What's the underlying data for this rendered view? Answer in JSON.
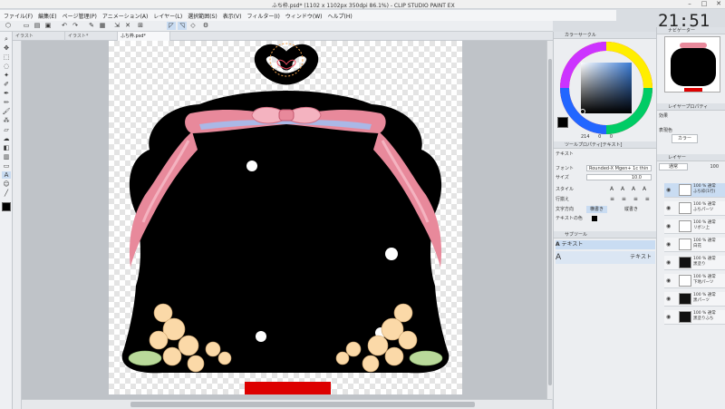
{
  "window": {
    "title": "ふち枠.psd* (1102 x 1102px 350dpi 86.1%) - CLIP STUDIO PAINT EX",
    "clock": "21:51"
  },
  "menu": [
    "ファイル(F)",
    "編集(E)",
    "ページ管理(P)",
    "アニメーション(A)",
    "レイヤー(L)",
    "選択範囲(S)",
    "表示(V)",
    "フィルター(I)",
    "ウィンドウ(W)",
    "ヘルプ(H)"
  ],
  "tabs": [
    "イラスト",
    "イラスト*",
    "ふち枠.psd*"
  ],
  "panels": {
    "color_circle": "カラーサークル",
    "navigator": "ナビゲーター",
    "layer_property": "レイヤープロパティ",
    "effect_label": "効果",
    "expression_label": "表現色",
    "expression_value": "カラー",
    "tool_property": "ツールプロパティ[テキスト]",
    "tool_name": "テキスト",
    "font_label": "フォント",
    "font_value": "Rounded-X Mgen+ 1c thin",
    "size_label": "サイズ",
    "size_value": "10.0",
    "style_label": "スタイル",
    "align_label": "行揃え",
    "direction_label": "文字方向",
    "direction_h": "横書き",
    "direction_v": "縦書き",
    "text_color_label": "テキストの色",
    "subtool_header": "サブツール",
    "subtool_item": "テキスト",
    "subtool_item2": "テキスト",
    "hue_val": "214",
    "sat_val": "0",
    "bri_val": "0"
  },
  "layers": {
    "header": "レイヤー",
    "blend": "通常",
    "opacity": "100",
    "items": [
      {
        "line1": "100 % 通常",
        "line2": "ふち枠(1行)",
        "selected": true,
        "dark": false
      },
      {
        "line1": "100 % 通常",
        "line2": "ふちパーツ",
        "selected": false,
        "dark": false
      },
      {
        "line1": "100 % 通常",
        "line2": "リボン上",
        "selected": false,
        "dark": false
      },
      {
        "line1": "100 % 通常",
        "line2": "白花",
        "selected": false,
        "dark": false
      },
      {
        "line1": "100 % 通常",
        "line2": "黒塗り",
        "selected": false,
        "dark": true
      },
      {
        "line1": "100 % 通常",
        "line2": "下地パーツ",
        "selected": false,
        "dark": false
      },
      {
        "line1": "100 % 通常",
        "line2": "黒パーツ",
        "selected": false,
        "dark": true
      },
      {
        "line1": "100 % 通常",
        "line2": "黒塗りふち",
        "selected": false,
        "dark": true
      }
    ]
  },
  "colors": {
    "accent": "#3a7bd5",
    "ribbon": "#e8899b",
    "ribbon_light": "#f4b3c0",
    "ribbon_blue": "#aab8e6",
    "frame": "#000000",
    "flower": "#fbd9a8",
    "leaf": "#b9d99a",
    "red_bar": "#dd0000"
  }
}
